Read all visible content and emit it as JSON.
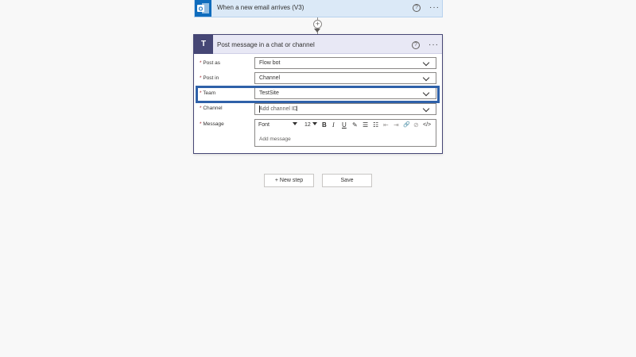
{
  "trigger": {
    "icon": "outlook-icon",
    "title": "When a new email arrives (V3)",
    "help_glyph": "?",
    "more_glyph": "···"
  },
  "connector": {
    "plus_glyph": "+"
  },
  "action": {
    "icon": "teams-icon",
    "icon_glyph": "T",
    "title": "Post message in a chat or channel",
    "help_glyph": "?",
    "more_glyph": "···",
    "required_mark": "*",
    "fields": {
      "post_as": {
        "label": "Post as",
        "value": "Flow bot"
      },
      "post_in": {
        "label": "Post in",
        "value": "Channel"
      },
      "team": {
        "label": "Team",
        "value": "TestSite"
      },
      "channel": {
        "label": "Channel",
        "placeholder": "Add channel ID"
      },
      "message": {
        "label": "Message",
        "placeholder": "Add message"
      }
    },
    "toolbar": {
      "font_label": "Font",
      "size_label": "12",
      "bold": "B",
      "italic": "I",
      "underline": "U",
      "color_picker": "✎",
      "bullet_list": "☰",
      "numbered_list": "☷",
      "outdent": "⇤",
      "indent": "⇥",
      "link": "🔗",
      "unlink": "⊘",
      "code_view": "</>"
    }
  },
  "buttons": {
    "new_step": "+ New step",
    "save": "Save"
  },
  "colors": {
    "highlight_border": "#2f61a9",
    "teams_brand": "#464775",
    "outlook_brand": "#0f6cbd"
  }
}
